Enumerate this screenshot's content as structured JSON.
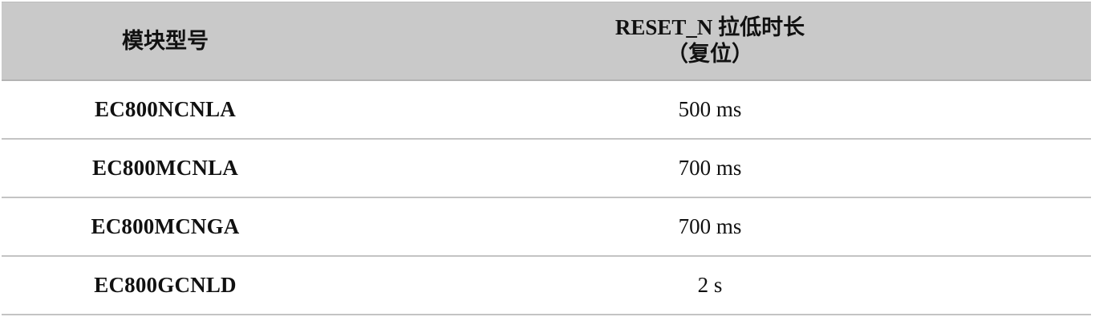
{
  "table": {
    "header": {
      "model": "模块型号",
      "duration_line1": "RESET_N 拉低时长",
      "duration_line2": "（复位）"
    },
    "rows": [
      {
        "model": "EC800NCNLA",
        "duration": "500 ms"
      },
      {
        "model": "EC800MCNLA",
        "duration": "700 ms"
      },
      {
        "model": "EC800MCNGA",
        "duration": "700 ms"
      },
      {
        "model": "EC800GCNLD",
        "duration": "2 s"
      }
    ]
  },
  "colors": {
    "header_background": "#c9c9c9",
    "row_divider": "#c4c4c4",
    "text": "#111111"
  }
}
